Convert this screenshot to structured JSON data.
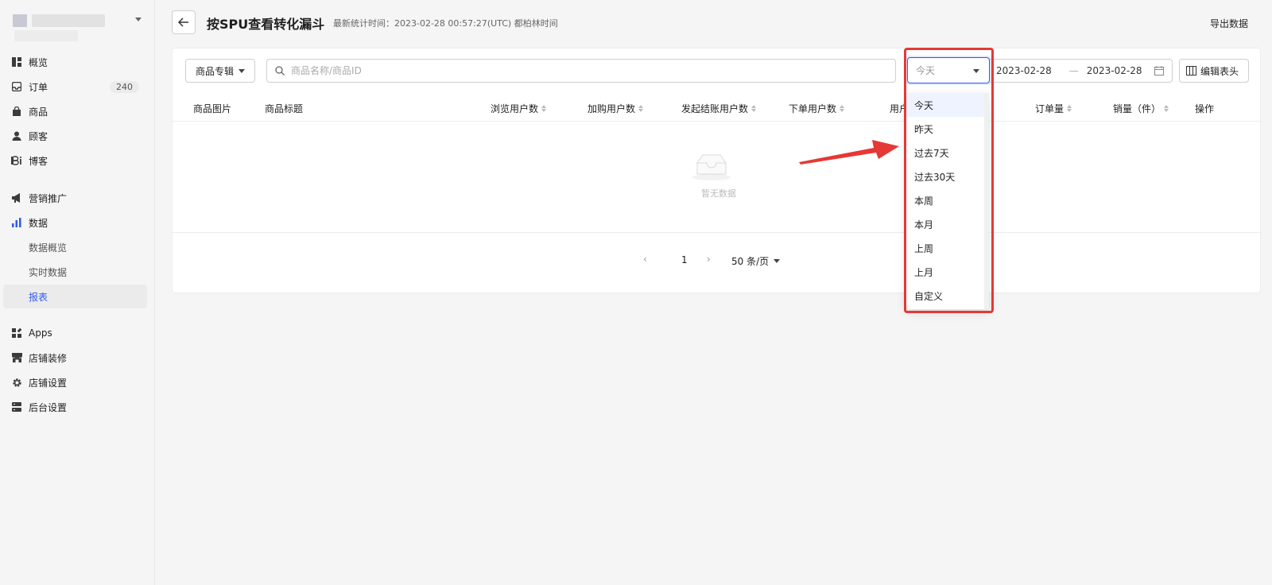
{
  "sidebar": {
    "items": [
      {
        "label": "概览",
        "icon": "overview-icon"
      },
      {
        "label": "订单",
        "icon": "inbox-icon",
        "badge": "240"
      },
      {
        "label": "商品",
        "icon": "bag-icon"
      },
      {
        "label": "顾客",
        "icon": "user-icon"
      },
      {
        "label": "博客",
        "icon": "blog-icon"
      },
      {
        "label": "营销推广",
        "icon": "megaphone-icon"
      },
      {
        "label": "数据",
        "icon": "bar-chart-icon"
      },
      {
        "label": "数据概览"
      },
      {
        "label": "实时数据"
      },
      {
        "label": "报表"
      },
      {
        "label": "Apps",
        "icon": "apps-icon"
      },
      {
        "label": "店铺装修",
        "icon": "store-icon"
      },
      {
        "label": "店铺设置",
        "icon": "gear-icon"
      },
      {
        "label": "后台设置",
        "icon": "server-icon"
      }
    ]
  },
  "header": {
    "title": "按SPU查看转化漏斗",
    "subtitle": "最新统计时间：2023-02-28 00:57:27(UTC) 都柏林时间",
    "export_label": "导出数据"
  },
  "filters": {
    "collection_label": "商品专辑",
    "search_placeholder": "商品名称/商品ID",
    "range_value": "今天",
    "date_start": "2023-02-28",
    "date_sep": "—",
    "date_end": "2023-02-28",
    "edit_columns_label": "编辑表头"
  },
  "table": {
    "columns": [
      "商品图片",
      "商品标题",
      "浏览用户数",
      "加购用户数",
      "发起结账用户数",
      "下单用户数",
      "用户",
      "订单量",
      "销量（件）",
      "操作"
    ],
    "empty_text": "暂无数据"
  },
  "pagination": {
    "current": "1",
    "page_size": "50 条/页"
  },
  "dropdown": {
    "options": [
      "今天",
      "昨天",
      "过去7天",
      "过去30天",
      "本周",
      "本月",
      "上周",
      "上月",
      "自定义"
    ]
  },
  "colors": {
    "accent": "#2f5bea",
    "highlight": "#e53935"
  }
}
